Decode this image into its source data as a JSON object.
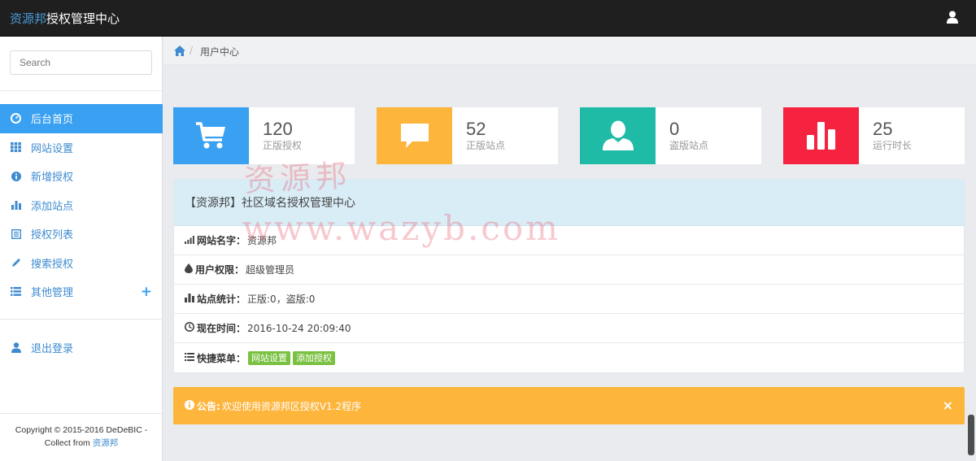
{
  "brand": {
    "highlight": "资源邦",
    "rest": "授权管理中心"
  },
  "search": {
    "placeholder": "Search"
  },
  "sidebar": {
    "items": [
      {
        "label": "后台首页",
        "icon": "dashboard-icon",
        "active": true
      },
      {
        "label": "网站设置",
        "icon": "grid-icon"
      },
      {
        "label": "新增授权",
        "icon": "info-icon"
      },
      {
        "label": "添加站点",
        "icon": "bar-chart-icon"
      },
      {
        "label": "授权列表",
        "icon": "list-alt-icon"
      },
      {
        "label": "搜索授权",
        "icon": "pencil-icon"
      },
      {
        "label": "其他管理",
        "icon": "list-icon",
        "expandable": true,
        "expand_symbol": "+"
      }
    ],
    "logout": {
      "label": "退出登录",
      "icon": "user-icon"
    },
    "copyright": {
      "line1": "Copyright © 2015-2016 DeDeBIC -",
      "line2_prefix": "Collect from ",
      "line2_link": "资源邦"
    }
  },
  "breadcrumb": {
    "current": "用户中心",
    "separator": "/"
  },
  "stats": [
    {
      "value": "120",
      "label": "正版授权",
      "icon": "shopping-cart-icon",
      "color": "#3aa0f1"
    },
    {
      "value": "52",
      "label": "正版站点",
      "icon": "comment-icon",
      "color": "#fdb53c"
    },
    {
      "value": "0",
      "label": "盗版站点",
      "icon": "user-icon",
      "color": "#1fbba6"
    },
    {
      "value": "25",
      "label": "运行时长",
      "icon": "bar-chart-icon",
      "color": "#f5233f"
    }
  ],
  "panel": {
    "title": "【资源邦】社区域名授权管理中心",
    "rows": [
      {
        "key": "网站名字：",
        "value": "资源邦",
        "icon": "signal-icon"
      },
      {
        "key": "用户权限：",
        "value": "超级管理员",
        "icon": "tint-icon"
      },
      {
        "key": "站点统计：",
        "value": "正版:0，盗版:0",
        "icon": "bar-chart-icon"
      },
      {
        "key": "现在时间：",
        "value": "2016-10-24 20:09:40",
        "icon": "clock-icon"
      },
      {
        "key": "快捷菜单：",
        "icon": "list-icon",
        "buttons": [
          "网站设置",
          "添加授权"
        ]
      }
    ]
  },
  "notice": {
    "label": "公告:",
    "text": "欢迎使用资源邦区授权V1.2程序",
    "close": "×"
  },
  "watermark": {
    "line1": "资源邦",
    "line2": "www.wazyb.com"
  },
  "colors": {
    "topbar": "#1f1f1f",
    "accent": "#3aa0f1",
    "link": "#3d8bd0",
    "green_button": "#7ac142",
    "notice": "#fdb53c"
  }
}
